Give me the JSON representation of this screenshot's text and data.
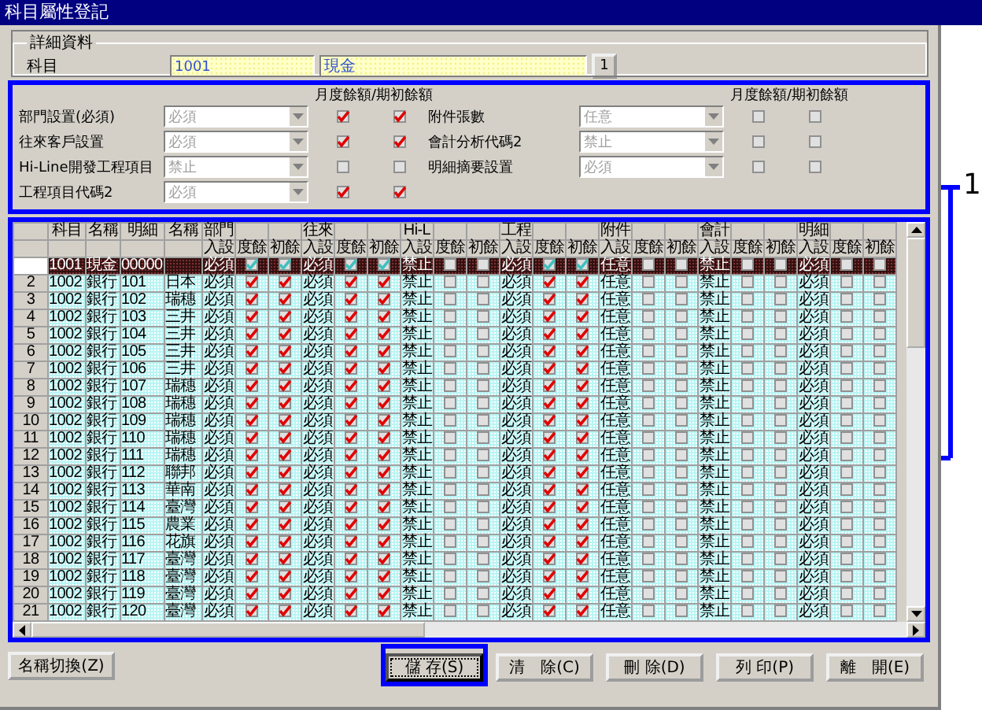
{
  "window": {
    "title": "科目屬性登記"
  },
  "details": {
    "title": "詳細資料",
    "label": "科目",
    "code": "1001",
    "name": "現金",
    "button": "1"
  },
  "settings": {
    "headers": [
      "月度餘額/期初餘額",
      "月度餘額/期初餘額"
    ],
    "left": [
      {
        "label": "部門設置(必須)",
        "value": "必須",
        "monthly": true,
        "opening": true
      },
      {
        "label": "往來客戶設置",
        "value": "必須",
        "monthly": true,
        "opening": true
      },
      {
        "label": "Hi-Line開發工程項目",
        "value": "禁止",
        "monthly": false,
        "opening": false
      },
      {
        "label": "工程項目代碼2",
        "value": "必須",
        "monthly": true,
        "opening": true
      }
    ],
    "right": [
      {
        "label": "附件張數",
        "value": "任意",
        "monthly": false,
        "opening": false
      },
      {
        "label": "會計分析代碼2",
        "value": "禁止",
        "monthly": false,
        "opening": false
      },
      {
        "label": "明細摘要設置",
        "value": "必須",
        "monthly": false,
        "opening": false
      }
    ]
  },
  "table": {
    "columns": [
      "科目",
      "名稱",
      "明細",
      "名稱"
    ],
    "groups": [
      {
        "name": "部門",
        "columns": [
          "入設",
          "度餘",
          "初餘"
        ]
      },
      {
        "name": "往來",
        "columns": [
          "入設",
          "度餘",
          "初餘"
        ]
      },
      {
        "name": "Hi-L",
        "columns": [
          "入設",
          "度餘",
          "初餘"
        ]
      },
      {
        "name": "工程",
        "columns": [
          "入設",
          "度餘",
          "初餘"
        ]
      },
      {
        "name": "附件",
        "columns": [
          "入設",
          "度餘",
          "初餘"
        ]
      },
      {
        "name": "會計",
        "columns": [
          "入設",
          "度餘",
          "初餘"
        ]
      },
      {
        "name": "明細",
        "columns": [
          "入設",
          "度餘",
          "初餘"
        ]
      }
    ],
    "rows": [
      {
        "account": "1001",
        "name": "現金",
        "detail": "00000",
        "selected": true,
        "groups": [
          {
            "value": "必須",
            "monthly": true,
            "opening": true
          },
          {
            "value": "必須",
            "monthly": true,
            "opening": true
          },
          {
            "value": "禁止",
            "monthly": false,
            "opening": false
          },
          {
            "value": "必須",
            "monthly": true,
            "opening": true
          },
          {
            "value": "任意",
            "monthly": false,
            "opening": false
          },
          {
            "value": "禁止",
            "monthly": false,
            "opening": false
          },
          {
            "value": "必須",
            "monthly": false,
            "opening": false
          }
        ]
      },
      {
        "num": "2",
        "account": "1002",
        "name": "銀行",
        "detail": "101",
        "name_2": "日本",
        "selected": false,
        "groups": [
          {
            "value": "必須",
            "monthly": true,
            "opening": true
          },
          {
            "value": "必須",
            "monthly": true,
            "opening": true
          },
          {
            "value": "禁止",
            "monthly": false,
            "opening": false
          },
          {
            "value": "必須",
            "monthly": true,
            "opening": true
          },
          {
            "value": "任意",
            "monthly": false,
            "opening": false
          },
          {
            "value": "禁止",
            "monthly": false,
            "opening": false
          },
          {
            "value": "必須",
            "monthly": false,
            "opening": false
          }
        ]
      },
      {
        "num": "3",
        "account": "1002",
        "name": "銀行",
        "detail": "102",
        "name_2": "瑞穗",
        "selected": false,
        "groups": [
          {
            "value": "必須",
            "monthly": true,
            "opening": true
          },
          {
            "value": "必須",
            "monthly": true,
            "opening": true
          },
          {
            "value": "禁止",
            "monthly": false,
            "opening": false
          },
          {
            "value": "必須",
            "monthly": true,
            "opening": true
          },
          {
            "value": "任意",
            "monthly": false,
            "opening": false
          },
          {
            "value": "禁止",
            "monthly": false,
            "opening": false
          },
          {
            "value": "必須",
            "monthly": false,
            "opening": false
          }
        ]
      },
      {
        "num": "4",
        "account": "1002",
        "name": "銀行",
        "detail": "103",
        "name_2": "三井",
        "selected": false,
        "groups": [
          {
            "value": "必須",
            "monthly": true,
            "opening": true
          },
          {
            "value": "必須",
            "monthly": true,
            "opening": true
          },
          {
            "value": "禁止",
            "monthly": false,
            "opening": false
          },
          {
            "value": "必須",
            "monthly": true,
            "opening": true
          },
          {
            "value": "任意",
            "monthly": false,
            "opening": false
          },
          {
            "value": "禁止",
            "monthly": false,
            "opening": false
          },
          {
            "value": "必須",
            "monthly": false,
            "opening": false
          }
        ]
      },
      {
        "num": "5",
        "account": "1002",
        "name": "銀行",
        "detail": "104",
        "name_2": "三井",
        "selected": false,
        "groups": [
          {
            "value": "必須",
            "monthly": true,
            "opening": true
          },
          {
            "value": "必須",
            "monthly": true,
            "opening": true
          },
          {
            "value": "禁止",
            "monthly": false,
            "opening": false
          },
          {
            "value": "必須",
            "monthly": true,
            "opening": true
          },
          {
            "value": "任意",
            "monthly": false,
            "opening": false
          },
          {
            "value": "禁止",
            "monthly": false,
            "opening": false
          },
          {
            "value": "必須",
            "monthly": false,
            "opening": false
          }
        ]
      },
      {
        "num": "6",
        "account": "1002",
        "name": "銀行",
        "detail": "105",
        "name_2": "三井",
        "selected": false,
        "groups": [
          {
            "value": "必須",
            "monthly": true,
            "opening": true
          },
          {
            "value": "必須",
            "monthly": true,
            "opening": true
          },
          {
            "value": "禁止",
            "monthly": false,
            "opening": false
          },
          {
            "value": "必須",
            "monthly": true,
            "opening": true
          },
          {
            "value": "任意",
            "monthly": false,
            "opening": false
          },
          {
            "value": "禁止",
            "monthly": false,
            "opening": false
          },
          {
            "value": "必須",
            "monthly": false,
            "opening": false
          }
        ]
      },
      {
        "num": "7",
        "account": "1002",
        "name": "銀行",
        "detail": "106",
        "name_2": "三井",
        "selected": false,
        "groups": [
          {
            "value": "必須",
            "monthly": true,
            "opening": true
          },
          {
            "value": "必須",
            "monthly": true,
            "opening": true
          },
          {
            "value": "禁止",
            "monthly": false,
            "opening": false
          },
          {
            "value": "必須",
            "monthly": true,
            "opening": true
          },
          {
            "value": "任意",
            "monthly": false,
            "opening": false
          },
          {
            "value": "禁止",
            "monthly": false,
            "opening": false
          },
          {
            "value": "必須",
            "monthly": false,
            "opening": false
          }
        ]
      },
      {
        "num": "8",
        "account": "1002",
        "name": "銀行",
        "detail": "107",
        "name_2": "瑞穗",
        "selected": false,
        "groups": [
          {
            "value": "必須",
            "monthly": true,
            "opening": true
          },
          {
            "value": "必須",
            "monthly": true,
            "opening": true
          },
          {
            "value": "禁止",
            "monthly": false,
            "opening": false
          },
          {
            "value": "必須",
            "monthly": true,
            "opening": true
          },
          {
            "value": "任意",
            "monthly": false,
            "opening": false
          },
          {
            "value": "禁止",
            "monthly": false,
            "opening": false
          },
          {
            "value": "必須",
            "monthly": false,
            "opening": false
          }
        ]
      },
      {
        "num": "9",
        "account": "1002",
        "name": "銀行",
        "detail": "108",
        "name_2": "瑞穗",
        "selected": false,
        "groups": [
          {
            "value": "必須",
            "monthly": true,
            "opening": true
          },
          {
            "value": "必須",
            "monthly": true,
            "opening": true
          },
          {
            "value": "禁止",
            "monthly": false,
            "opening": false
          },
          {
            "value": "必須",
            "monthly": true,
            "opening": true
          },
          {
            "value": "任意",
            "monthly": false,
            "opening": false
          },
          {
            "value": "禁止",
            "monthly": false,
            "opening": false
          },
          {
            "value": "必須",
            "monthly": false,
            "opening": false
          }
        ]
      },
      {
        "num": "10",
        "account": "1002",
        "name": "銀行",
        "detail": "109",
        "name_2": "瑞穗",
        "selected": false,
        "groups": [
          {
            "value": "必須",
            "monthly": true,
            "opening": true
          },
          {
            "value": "必須",
            "monthly": true,
            "opening": true
          },
          {
            "value": "禁止",
            "monthly": false,
            "opening": false
          },
          {
            "value": "必須",
            "monthly": true,
            "opening": true
          },
          {
            "value": "任意",
            "monthly": false,
            "opening": false
          },
          {
            "value": "禁止",
            "monthly": false,
            "opening": false
          },
          {
            "value": "必須",
            "monthly": false,
            "opening": false
          }
        ]
      },
      {
        "num": "11",
        "account": "1002",
        "name": "銀行",
        "detail": "110",
        "name_2": "瑞穗",
        "selected": false,
        "groups": [
          {
            "value": "必須",
            "monthly": true,
            "opening": true
          },
          {
            "value": "必須",
            "monthly": true,
            "opening": true
          },
          {
            "value": "禁止",
            "monthly": false,
            "opening": false
          },
          {
            "value": "必須",
            "monthly": true,
            "opening": true
          },
          {
            "value": "任意",
            "monthly": false,
            "opening": false
          },
          {
            "value": "禁止",
            "monthly": false,
            "opening": false
          },
          {
            "value": "必須",
            "monthly": false,
            "opening": false
          }
        ]
      },
      {
        "num": "12",
        "account": "1002",
        "name": "銀行",
        "detail": "111",
        "name_2": "瑞穗",
        "selected": false,
        "groups": [
          {
            "value": "必須",
            "monthly": true,
            "opening": true
          },
          {
            "value": "必須",
            "monthly": true,
            "opening": true
          },
          {
            "value": "禁止",
            "monthly": false,
            "opening": false
          },
          {
            "value": "必須",
            "monthly": true,
            "opening": true
          },
          {
            "value": "任意",
            "monthly": false,
            "opening": false
          },
          {
            "value": "禁止",
            "monthly": false,
            "opening": false
          },
          {
            "value": "必須",
            "monthly": false,
            "opening": false
          }
        ]
      },
      {
        "num": "13",
        "account": "1002",
        "name": "銀行",
        "detail": "112",
        "name_2": "聯邦",
        "selected": false,
        "groups": [
          {
            "value": "必須",
            "monthly": true,
            "opening": true
          },
          {
            "value": "必須",
            "monthly": true,
            "opening": true
          },
          {
            "value": "禁止",
            "monthly": false,
            "opening": false
          },
          {
            "value": "必須",
            "monthly": true,
            "opening": true
          },
          {
            "value": "任意",
            "monthly": false,
            "opening": false
          },
          {
            "value": "禁止",
            "monthly": false,
            "opening": false
          },
          {
            "value": "必須",
            "monthly": false,
            "opening": false
          }
        ]
      },
      {
        "num": "14",
        "account": "1002",
        "name": "銀行",
        "detail": "113",
        "name_2": "華南",
        "selected": false,
        "groups": [
          {
            "value": "必須",
            "monthly": true,
            "opening": true
          },
          {
            "value": "必須",
            "monthly": true,
            "opening": true
          },
          {
            "value": "禁止",
            "monthly": false,
            "opening": false
          },
          {
            "value": "必須",
            "monthly": true,
            "opening": true
          },
          {
            "value": "任意",
            "monthly": false,
            "opening": false
          },
          {
            "value": "禁止",
            "monthly": false,
            "opening": false
          },
          {
            "value": "必須",
            "monthly": false,
            "opening": false
          }
        ]
      },
      {
        "num": "15",
        "account": "1002",
        "name": "銀行",
        "detail": "114",
        "name_2": "臺灣",
        "selected": false,
        "groups": [
          {
            "value": "必須",
            "monthly": true,
            "opening": true
          },
          {
            "value": "必須",
            "monthly": true,
            "opening": true
          },
          {
            "value": "禁止",
            "monthly": false,
            "opening": false
          },
          {
            "value": "必須",
            "monthly": true,
            "opening": true
          },
          {
            "value": "任意",
            "monthly": false,
            "opening": false
          },
          {
            "value": "禁止",
            "monthly": false,
            "opening": false
          },
          {
            "value": "必須",
            "monthly": false,
            "opening": false
          }
        ]
      },
      {
        "num": "16",
        "account": "1002",
        "name": "銀行",
        "detail": "115",
        "name_2": "農業",
        "selected": false,
        "groups": [
          {
            "value": "必須",
            "monthly": true,
            "opening": true
          },
          {
            "value": "必須",
            "monthly": true,
            "opening": true
          },
          {
            "value": "禁止",
            "monthly": false,
            "opening": false
          },
          {
            "value": "必須",
            "monthly": true,
            "opening": true
          },
          {
            "value": "任意",
            "monthly": false,
            "opening": false
          },
          {
            "value": "禁止",
            "monthly": false,
            "opening": false
          },
          {
            "value": "必須",
            "monthly": false,
            "opening": false
          }
        ]
      },
      {
        "num": "17",
        "account": "1002",
        "name": "銀行",
        "detail": "116",
        "name_2": "花旗",
        "selected": false,
        "groups": [
          {
            "value": "必須",
            "monthly": true,
            "opening": true
          },
          {
            "value": "必須",
            "monthly": true,
            "opening": true
          },
          {
            "value": "禁止",
            "monthly": false,
            "opening": false
          },
          {
            "value": "必須",
            "monthly": true,
            "opening": true
          },
          {
            "value": "任意",
            "monthly": false,
            "opening": false
          },
          {
            "value": "禁止",
            "monthly": false,
            "opening": false
          },
          {
            "value": "必須",
            "monthly": false,
            "opening": false
          }
        ]
      },
      {
        "num": "18",
        "account": "1002",
        "name": "銀行",
        "detail": "117",
        "name_2": "臺灣",
        "selected": false,
        "groups": [
          {
            "value": "必須",
            "monthly": true,
            "opening": true
          },
          {
            "value": "必須",
            "monthly": true,
            "opening": true
          },
          {
            "value": "禁止",
            "monthly": false,
            "opening": false
          },
          {
            "value": "必須",
            "monthly": true,
            "opening": true
          },
          {
            "value": "任意",
            "monthly": false,
            "opening": false
          },
          {
            "value": "禁止",
            "monthly": false,
            "opening": false
          },
          {
            "value": "必須",
            "monthly": false,
            "opening": false
          }
        ]
      },
      {
        "num": "19",
        "account": "1002",
        "name": "銀行",
        "detail": "118",
        "name_2": "臺灣",
        "selected": false,
        "groups": [
          {
            "value": "必須",
            "monthly": true,
            "opening": true
          },
          {
            "value": "必須",
            "monthly": true,
            "opening": true
          },
          {
            "value": "禁止",
            "monthly": false,
            "opening": false
          },
          {
            "value": "必須",
            "monthly": true,
            "opening": true
          },
          {
            "value": "任意",
            "monthly": false,
            "opening": false
          },
          {
            "value": "禁止",
            "monthly": false,
            "opening": false
          },
          {
            "value": "必須",
            "monthly": false,
            "opening": false
          }
        ]
      },
      {
        "num": "20",
        "account": "1002",
        "name": "銀行",
        "detail": "119",
        "name_2": "臺灣",
        "selected": false,
        "groups": [
          {
            "value": "必須",
            "monthly": true,
            "opening": true
          },
          {
            "value": "必須",
            "monthly": true,
            "opening": true
          },
          {
            "value": "禁止",
            "monthly": false,
            "opening": false
          },
          {
            "value": "必須",
            "monthly": true,
            "opening": true
          },
          {
            "value": "任意",
            "monthly": false,
            "opening": false
          },
          {
            "value": "禁止",
            "monthly": false,
            "opening": false
          },
          {
            "value": "必須",
            "monthly": false,
            "opening": false
          }
        ]
      },
      {
        "num": "21",
        "account": "1002",
        "name": "銀行",
        "detail": "120",
        "name_2": "臺灣",
        "selected": false,
        "groups": [
          {
            "value": "必須",
            "monthly": true,
            "opening": true
          },
          {
            "value": "必須",
            "monthly": true,
            "opening": true
          },
          {
            "value": "禁止",
            "monthly": false,
            "opening": false
          },
          {
            "value": "必須",
            "monthly": true,
            "opening": true
          },
          {
            "value": "任意",
            "monthly": false,
            "opening": false
          },
          {
            "value": "禁止",
            "monthly": false,
            "opening": false
          },
          {
            "value": "必須",
            "monthly": false,
            "opening": false
          }
        ]
      }
    ]
  },
  "buttons": {
    "left": "名稱切換(Z)",
    "right": [
      {
        "label": "儲 存(S)",
        "highlighted": true
      },
      {
        "label": "清　除(C)",
        "highlighted": false
      },
      {
        "label": "刪 除(D)",
        "highlighted": false
      },
      {
        "label": "列 印(P)",
        "highlighted": false
      },
      {
        "label": "離　開(E)",
        "highlighted": false
      }
    ]
  },
  "callout": "1"
}
